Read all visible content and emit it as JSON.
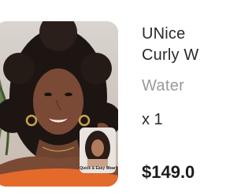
{
  "product": {
    "title_line1": "UNice",
    "title_line2": "Curly W",
    "variant": "Water",
    "quantity": "x 1",
    "price": "$149.0",
    "thumbnail_label": "Quick & Easy Wear"
  },
  "colors": {
    "text_dark": "#2a2a2a",
    "text_muted": "#9a9a9a",
    "image_bg": "#d9d4cf"
  }
}
